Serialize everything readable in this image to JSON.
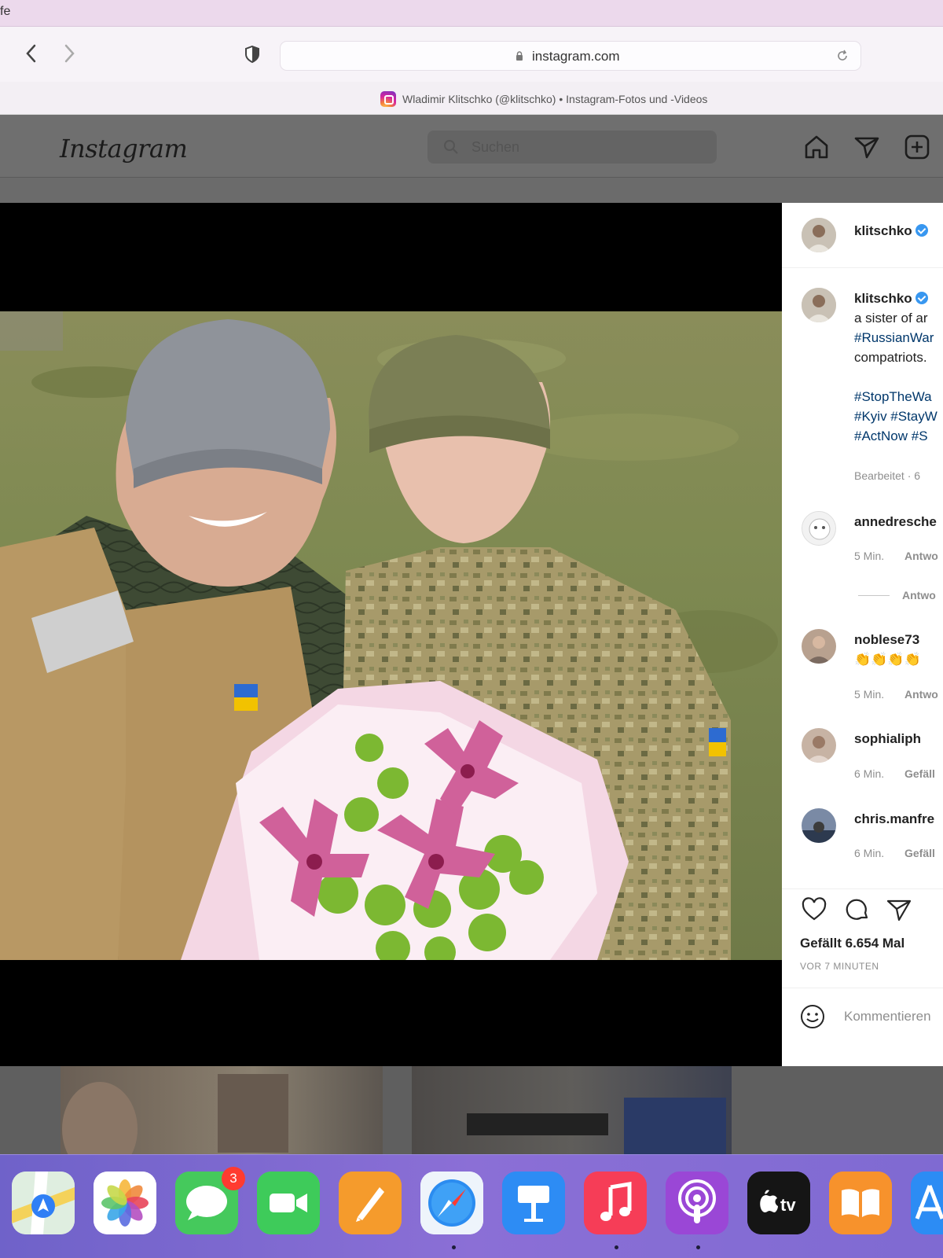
{
  "app_title_fragment": "fe",
  "browser": {
    "url": "instagram.com",
    "tab_title": "Wladimir Klitschko (@klitschko) • Instagram-Fotos und -Videos",
    "back_icon": "chevron-left-icon",
    "forward_icon": "chevron-right-icon",
    "reload_icon": "reload-icon"
  },
  "instagram": {
    "logo": "Instagram",
    "search_placeholder": "Suchen",
    "header_icons": [
      "home-icon",
      "direct-icon",
      "new-post-icon"
    ]
  },
  "post": {
    "username": "klitschko",
    "caption_user": "klitschko",
    "caption_lines": [
      "a sister of ar",
      "#RussianWar",
      "compatriots."
    ],
    "hashtag_lines": [
      "#StopTheWa",
      "#Kyiv #StayW",
      "#ActNow #S"
    ],
    "edited_meta": "Bearbeitet · 6",
    "comments": [
      {
        "user": "annedresche",
        "meta_time": "5 Min.",
        "meta_action": "Antwo",
        "replies": "Antwo"
      },
      {
        "user": "noblese73",
        "emoji": "👏👏👏👏",
        "meta_time": "5 Min.",
        "meta_action": "Antwo"
      },
      {
        "user": "sophialiph",
        "meta_time": "6 Min.",
        "meta_action": "Gefäll"
      },
      {
        "user": "chris.manfre",
        "meta_time": "6 Min.",
        "meta_action": "Gefäll"
      }
    ],
    "likes": "Gefällt 6.654 Mal",
    "time_ago": "VOR 7 MINUTEN",
    "comment_placeholder": "Kommentieren"
  },
  "dock": {
    "apps": [
      "Maps",
      "Photos",
      "Messages",
      "FaceTime",
      "Pages",
      "Safari",
      "Keynote",
      "Music",
      "Podcasts",
      "TV",
      "Books",
      "App Store"
    ],
    "messages_badge": "3",
    "tv_label": "tv"
  },
  "colors": {
    "accent_blue": "#3897f0",
    "badge_red": "#ff3b30",
    "dock": "#7f6ad2"
  }
}
